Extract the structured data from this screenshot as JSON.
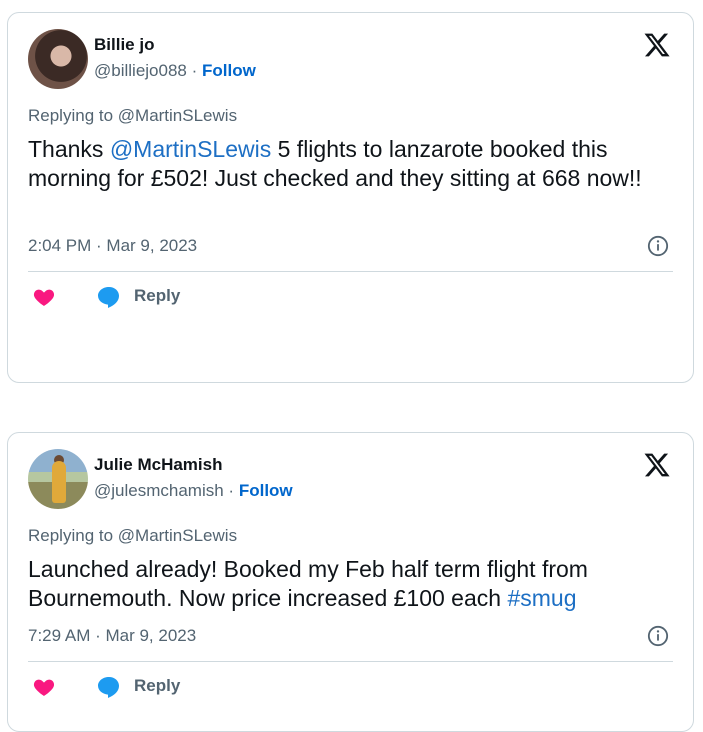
{
  "tweets": [
    {
      "name": "Billie jo",
      "handle": "@billiejo088",
      "separator": "·",
      "follow": "Follow",
      "reply_to": "Replying to @MartinSLewis",
      "text_parts": {
        "a": "Thanks ",
        "mention": "@MartinSLewis",
        "b": " 5 flights to lanzarote booked this morning for £502! Just checked and they sitting at 668 now!!"
      },
      "timestamp": "2:04 PM · Mar 9, 2023",
      "reply_label": "Reply"
    },
    {
      "name": "Julie McHamish",
      "handle": "@julesmchamish",
      "separator": "·",
      "follow": "Follow",
      "reply_to": "Replying to @MartinSLewis",
      "text_parts": {
        "a": "Launched already! Booked my Feb half term flight from Bournemouth. Now price increased £100 each ",
        "hashtag": "#smug"
      },
      "timestamp": "7:29 AM · Mar 9, 2023",
      "reply_label": "Reply"
    }
  ],
  "icons": {
    "brand": "x-logo-icon",
    "info": "info-icon",
    "like": "heart-icon",
    "reply": "speech-bubble-icon"
  },
  "colors": {
    "like": "#f91880",
    "reply": "#1d9bf0",
    "link": "#1d6fc4",
    "follow": "#0066cc",
    "muted": "#536471"
  }
}
